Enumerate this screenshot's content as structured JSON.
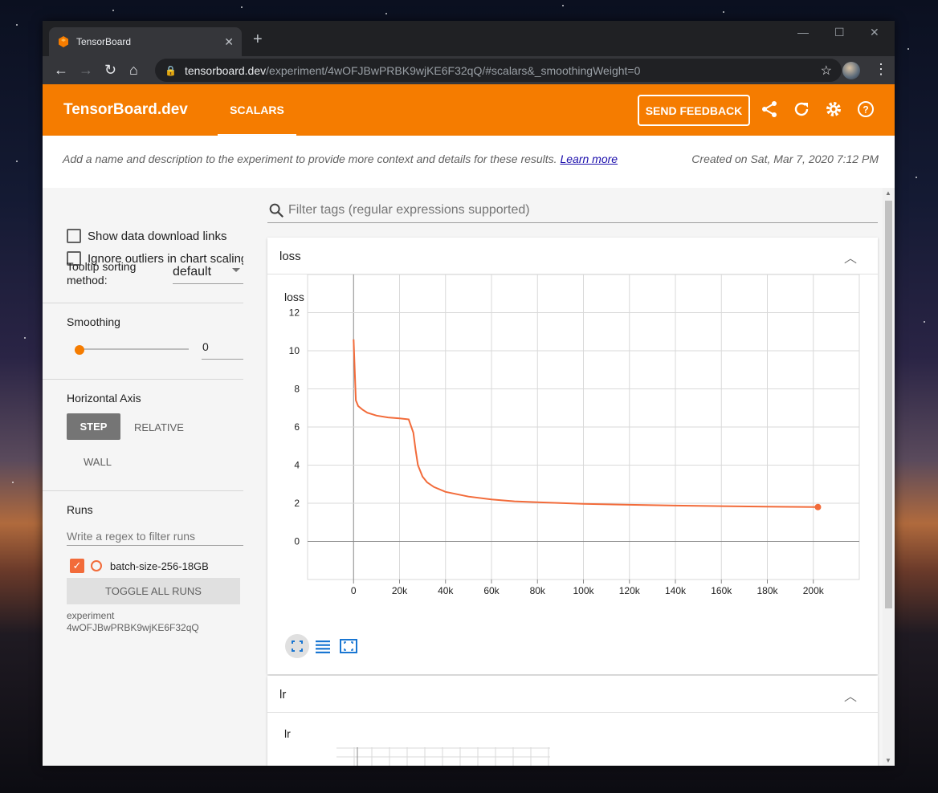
{
  "browser": {
    "tab_title": "TensorBoard",
    "url_host": "tensorboard.dev",
    "url_path": "/experiment/4wOFJBwPRBK9wjKE6F32qQ/#scalars&_smoothingWeight=0"
  },
  "header": {
    "brand": "TensorBoard.dev",
    "tab": "SCALARS",
    "feedback": "SEND FEEDBACK",
    "accent": "#f57c00"
  },
  "description": {
    "text": "Add a name and description to the experiment to provide more context and details for these results.",
    "link": "Learn more",
    "created": "Created on Sat, Mar 7, 2020 7:12 PM"
  },
  "sidebar": {
    "show_download": "Show data download links",
    "ignore_outliers": "Ignore outliers in chart scaling",
    "sorting_label": "Tooltip sorting method:",
    "sorting_value": "default",
    "smoothing_title": "Smoothing",
    "smoothing_value": "0",
    "horizontal_axis_title": "Horizontal Axis",
    "axis_step": "STEP",
    "axis_relative": "RELATIVE",
    "axis_wall": "WALL",
    "runs_title": "Runs",
    "runs_filter_placeholder": "Write a regex to filter runs",
    "run_name": "batch-size-256-18GB",
    "toggle_all": "TOGGLE ALL RUNS",
    "experiment_label": "experiment",
    "experiment_id": "4wOFJBwPRBK9wjKE6F32qQ"
  },
  "main": {
    "filter_placeholder": "Filter tags (regular expressions supported)",
    "card_loss": "loss",
    "chart_loss_title": "loss",
    "card_lr": "lr",
    "chart_lr_title": "lr"
  },
  "chart_data": {
    "type": "line",
    "title": "loss",
    "xlabel": "",
    "ylabel": "",
    "xlim": [
      -20000,
      220000
    ],
    "ylim": [
      -2,
      14
    ],
    "x_ticks": [
      "0",
      "20k",
      "40k",
      "60k",
      "80k",
      "100k",
      "120k",
      "140k",
      "160k",
      "180k",
      "200k"
    ],
    "y_ticks": [
      "0",
      "2",
      "4",
      "6",
      "8",
      "10",
      "12"
    ],
    "grid": true,
    "series": [
      {
        "name": "batch-size-256-18GB",
        "color": "#f26b3a",
        "x": [
          0,
          1000,
          2000,
          4000,
          6000,
          10000,
          15000,
          20000,
          24000,
          26000,
          27000,
          28000,
          30000,
          32000,
          35000,
          40000,
          50000,
          60000,
          70000,
          80000,
          100000,
          120000,
          140000,
          160000,
          180000,
          202000
        ],
        "y": [
          10.6,
          7.4,
          7.1,
          6.9,
          6.75,
          6.6,
          6.5,
          6.45,
          6.4,
          5.7,
          4.8,
          4.0,
          3.4,
          3.1,
          2.85,
          2.6,
          2.35,
          2.2,
          2.1,
          2.05,
          1.97,
          1.92,
          1.88,
          1.85,
          1.82,
          1.8
        ]
      }
    ]
  }
}
